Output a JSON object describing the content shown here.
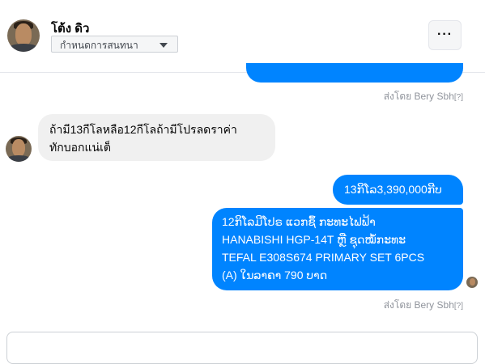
{
  "header": {
    "name": "โต้ง ดิว",
    "nickname_button": "กำหนดการสนทนา",
    "more_label": "···"
  },
  "messages": {
    "sent_by_1": "ส่งโดย Bery Sbh",
    "sent_by_q": "[?]",
    "incoming_line1": "ถ้ามี13กีโลหลือ12กีโลถ้ามีโปรลดราค่า",
    "incoming_line2": "ทักบอกแน่เต็",
    "out_price": "13ກິໂລ3,390,000ກີບ",
    "out_promo_line1": "12ກິໂລມີໂປຣ ແວກຊຶ້ ກະທະໄຟຟ້າ",
    "out_promo_line2": "HANABISHI HGP-14T ຫຼື ຊຸດໝໍ້ກະທະ",
    "out_promo_line3": "TEFAL E308S674 PRIMARY SET 6PCS",
    "out_promo_line4": "(A) ໃນລາຄາ 790 ບາດ",
    "sent_by_2": "ส่งโดย Bery Sbh"
  },
  "colors": {
    "outgoing_bubble": "#0084ff",
    "incoming_bubble": "#f0f0f0"
  }
}
